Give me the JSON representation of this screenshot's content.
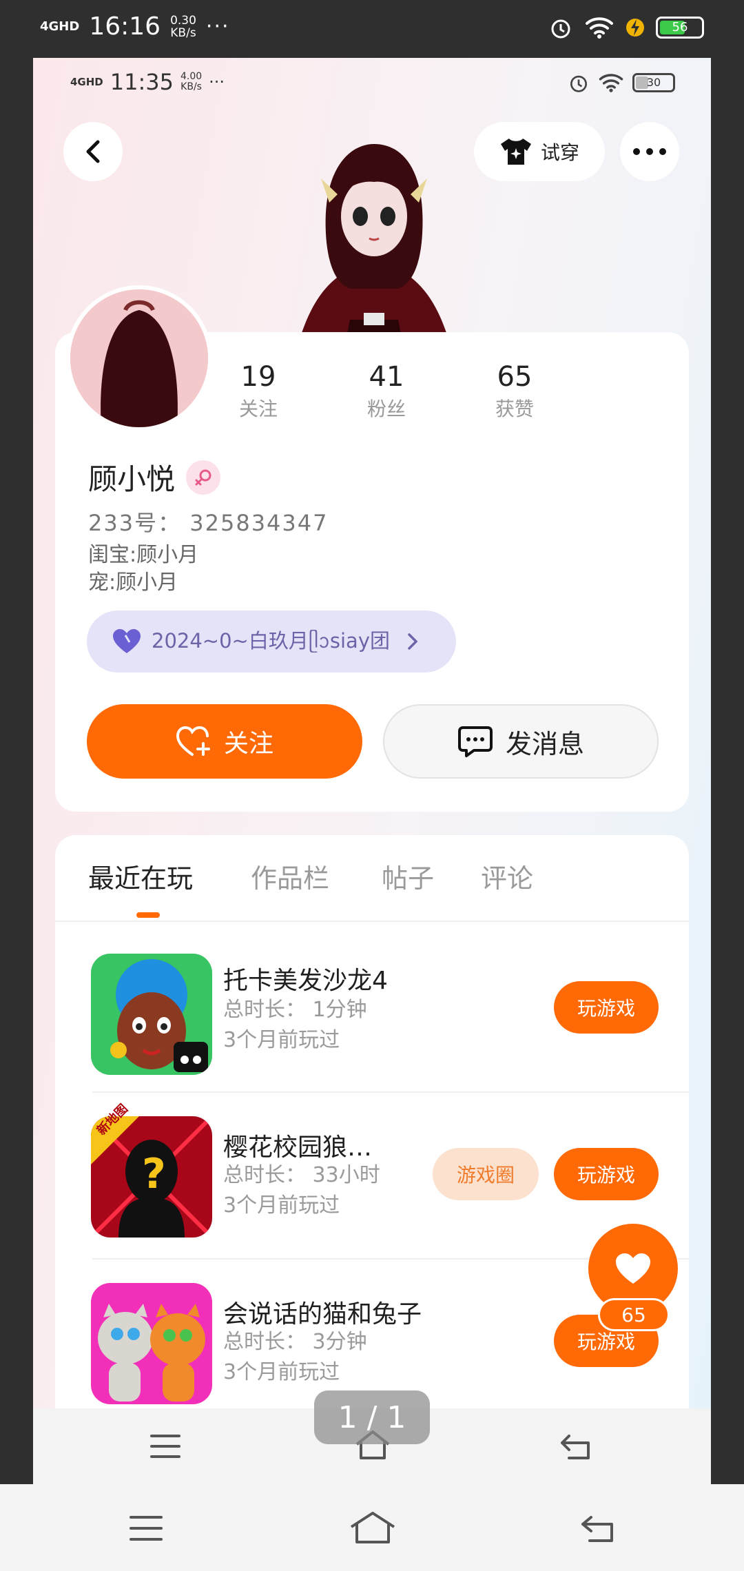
{
  "outer_status": {
    "signal": "4GHD",
    "time": "16:16",
    "speed_value": "0.30",
    "speed_unit": "KB/s",
    "more": "···",
    "battery": "56"
  },
  "inner_status": {
    "signal": "4GHD",
    "time": "11:35",
    "speed_value": "4.00",
    "speed_unit": "KB/s",
    "more": "···",
    "battery": "30"
  },
  "header": {
    "try_on_label": "试穿"
  },
  "profile": {
    "name": "顾小悦",
    "uid_line": "233号： 325834347",
    "bio_line1": "闺宝:顾小月",
    "bio_line2": "宠:顾小月",
    "group_label": "2024~0~白玖月ᥫᩣsiay团",
    "follow_label": "关注",
    "message_label": "发消息",
    "stats": [
      {
        "value": "19",
        "label": "关注"
      },
      {
        "value": "41",
        "label": "粉丝"
      },
      {
        "value": "65",
        "label": "获赞"
      }
    ]
  },
  "tabs": [
    "最近在玩",
    "作品栏",
    "帖子",
    "评论"
  ],
  "games": [
    {
      "title": "托卡美发沙龙4",
      "duration": "总时长： 1分钟",
      "last_played": "3个月前玩过",
      "play_label": "玩游戏"
    },
    {
      "title": "樱花校园狼…",
      "duration": "总时长： 33小时",
      "last_played": "3个月前玩过",
      "play_label": "玩游戏",
      "circle_label": "游戏圈",
      "badge": "新地图"
    },
    {
      "title": "会说话的猫和兔子",
      "duration": "总时长： 3分钟",
      "last_played": "3个月前玩过",
      "play_label": "玩游戏"
    }
  ],
  "like_float": {
    "count": "65"
  },
  "page_indicator": "1 / 1",
  "colors": {
    "accent": "#ff6a07",
    "purple": "#6a64a8"
  }
}
